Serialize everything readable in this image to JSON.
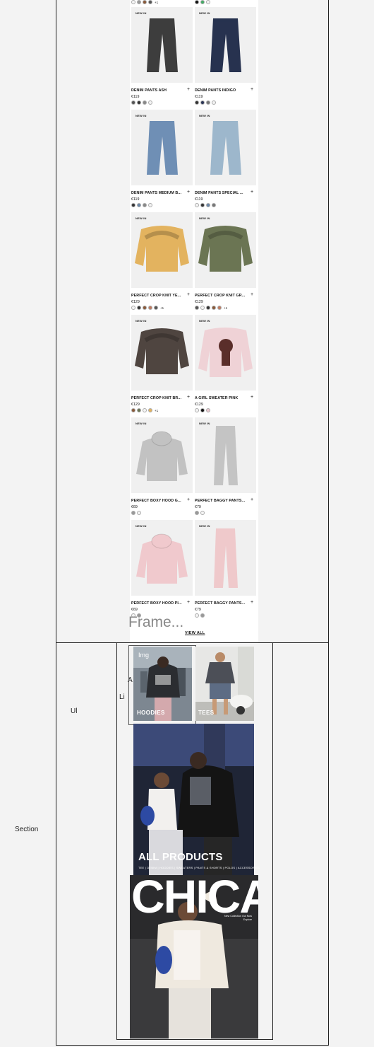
{
  "top_row": {
    "left_more": "+1"
  },
  "products": [
    {
      "badge": "NEW IN",
      "name": "DENIM PANTS ASH",
      "price": "€119",
      "swatches": [
        "#555",
        "#333",
        "#888",
        "#f2f2f2"
      ],
      "more": "",
      "kind": "jeans",
      "color": "#3d3d3d"
    },
    {
      "badge": "NEW IN",
      "name": "DENIM PANTS INDIGO",
      "price": "€119",
      "swatches": [
        "#333",
        "#2b3656",
        "#777",
        "#f2f2f2"
      ],
      "more": "",
      "kind": "jeans",
      "color": "#27324f"
    },
    {
      "badge": "NEW IN",
      "name": "DENIM PANTS MEDIUM B...",
      "price": "€119",
      "swatches": [
        "#333",
        "#6b87a8",
        "#888",
        "#f2f2f2"
      ],
      "more": "",
      "kind": "jeans",
      "color": "#6f8fb5"
    },
    {
      "badge": "NEW IN",
      "name": "DENIM PANTS SPECIAL ...",
      "price": "€119",
      "swatches": [
        "#f5f5f5",
        "#333",
        "#6b87a8",
        "#777"
      ],
      "more": "",
      "kind": "jeans",
      "color": "#9db7cc"
    },
    {
      "badge": "NEW IN",
      "name": "PERFECT CROP KNIT YE...",
      "price": "€129",
      "swatches": [
        "#f5f5f5",
        "#333",
        "#8a5a3a",
        "#c07a60",
        "#555"
      ],
      "more": "+1",
      "kind": "knit",
      "color": "#e3b35f"
    },
    {
      "badge": "NEW IN",
      "name": "PERFECT CROP KNIT GR...",
      "price": "€129",
      "swatches": [
        "#555",
        "#f5f5f5",
        "#333",
        "#8a5a3a",
        "#c07a60"
      ],
      "more": "+1",
      "kind": "knit",
      "color": "#6b7553"
    },
    {
      "badge": "NEW IN",
      "name": "PERFECT CROP KNIT BR...",
      "price": "€129",
      "swatches": [
        "#8a5a3a",
        "#6b7553",
        "#f5f5f5",
        "#e3b35f"
      ],
      "more": "+1",
      "kind": "knit",
      "color": "#4f4540"
    },
    {
      "badge": "NEW IN",
      "name": "A GIRL SWEATER PINK",
      "price": "€129",
      "swatches": [
        "#f5f5f5",
        "#111",
        "#e9c9cf"
      ],
      "more": "",
      "kind": "sweater",
      "color": "#efd2d6"
    },
    {
      "badge": "NEW IN",
      "name": "PERFECT BOXY HOOD G...",
      "price": "€69",
      "swatches": [
        "#999",
        "#f5f5f5"
      ],
      "more": "",
      "kind": "hood",
      "color": "#c2c2c2"
    },
    {
      "badge": "NEW IN",
      "name": "PERFECT BAGGY PANTS...",
      "price": "€79",
      "swatches": [
        "#999",
        "#f5f5f5"
      ],
      "more": "",
      "kind": "pants",
      "color": "#c4c4c4"
    },
    {
      "badge": "NEW IN",
      "name": "PERFECT BOXY HOOD PI...",
      "price": "€69",
      "swatches": [
        "#f5f5f5",
        "#999"
      ],
      "more": "",
      "kind": "hood",
      "color": "#f0c9cd"
    },
    {
      "badge": "NEW IN",
      "name": "PERFECT BAGGY PANTS...",
      "price": "€79",
      "swatches": [
        "#f5f5f5",
        "#999"
      ],
      "more": "",
      "kind": "pants",
      "color": "#efc9cb"
    }
  ],
  "frame_label": "Frame...",
  "view_all": "VIEW ALL",
  "outline_labels": {
    "section": "Section",
    "ul": "Ul",
    "li": "Li",
    "a": "A",
    "img": "Img"
  },
  "categories": [
    {
      "label": "HOODIES"
    },
    {
      "label": "TEES"
    }
  ],
  "all_products": {
    "title": "ALL PRODUCTS",
    "links": "TEE | DENIM | HOODIES | SWEATERS | PANTS & SHORTS | POLOS | ACCESSORIES"
  },
  "chica": {
    "title": "CHICA",
    "sub": "New Collection Out Now\nExplore"
  },
  "colors": {
    "accent": "#ffffff",
    "line": "#222222",
    "page_bg": "#f3f3f3"
  }
}
